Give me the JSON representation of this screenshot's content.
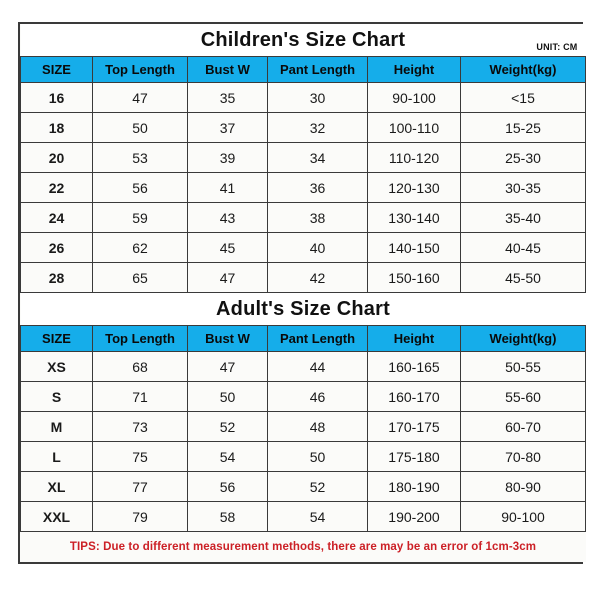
{
  "colors": {
    "header_cyan": "#15adea",
    "border_gray": "#3a3a3a",
    "cell_bg": "#fbfbf9",
    "tips_red": "#cc2026",
    "text_black": "#111111",
    "page_bg": "#ffffff"
  },
  "children_chart": {
    "title": "Children's Size Chart",
    "unit": "UNIT: CM",
    "columns": [
      "SIZE",
      "Top Length",
      "Bust W",
      "Pant Length",
      "Height",
      "Weight(kg)"
    ],
    "rows": [
      [
        "16",
        "47",
        "35",
        "30",
        "90-100",
        "<15"
      ],
      [
        "18",
        "50",
        "37",
        "32",
        "100-110",
        "15-25"
      ],
      [
        "20",
        "53",
        "39",
        "34",
        "110-120",
        "25-30"
      ],
      [
        "22",
        "56",
        "41",
        "36",
        "120-130",
        "30-35"
      ],
      [
        "24",
        "59",
        "43",
        "38",
        "130-140",
        "35-40"
      ],
      [
        "26",
        "62",
        "45",
        "40",
        "140-150",
        "40-45"
      ],
      [
        "28",
        "65",
        "47",
        "42",
        "150-160",
        "45-50"
      ]
    ]
  },
  "adult_chart": {
    "title": "Adult's Size Chart",
    "columns": [
      "SIZE",
      "Top Length",
      "Bust W",
      "Pant Length",
      "Height",
      "Weight(kg)"
    ],
    "rows": [
      [
        "XS",
        "68",
        "47",
        "44",
        "160-165",
        "50-55"
      ],
      [
        "S",
        "71",
        "50",
        "46",
        "160-170",
        "55-60"
      ],
      [
        "M",
        "73",
        "52",
        "48",
        "170-175",
        "60-70"
      ],
      [
        "L",
        "75",
        "54",
        "50",
        "175-180",
        "70-80"
      ],
      [
        "XL",
        "77",
        "56",
        "52",
        "180-190",
        "80-90"
      ],
      [
        "XXL",
        "79",
        "58",
        "54",
        "190-200",
        "90-100"
      ]
    ]
  },
  "footer": {
    "tips": "TIPS: Due to different measurement methods, there are may be an error of 1cm-3cm"
  },
  "chart_data": {
    "type": "table",
    "title": "Children's and Adult's Size Chart",
    "unit": "CM",
    "tables": [
      {
        "name": "Children's Size Chart",
        "columns": [
          "SIZE",
          "Top Length",
          "Bust W",
          "Pant Length",
          "Height",
          "Weight(kg)"
        ],
        "rows": [
          [
            "16",
            "47",
            "35",
            "30",
            "90-100",
            "<15"
          ],
          [
            "18",
            "50",
            "37",
            "32",
            "100-110",
            "15-25"
          ],
          [
            "20",
            "53",
            "39",
            "34",
            "110-120",
            "25-30"
          ],
          [
            "22",
            "56",
            "41",
            "36",
            "120-130",
            "30-35"
          ],
          [
            "24",
            "59",
            "43",
            "38",
            "130-140",
            "35-40"
          ],
          [
            "26",
            "62",
            "45",
            "40",
            "140-150",
            "40-45"
          ],
          [
            "28",
            "65",
            "47",
            "42",
            "150-160",
            "45-50"
          ]
        ]
      },
      {
        "name": "Adult's Size Chart",
        "columns": [
          "SIZE",
          "Top Length",
          "Bust W",
          "Pant Length",
          "Height",
          "Weight(kg)"
        ],
        "rows": [
          [
            "XS",
            "68",
            "47",
            "44",
            "160-165",
            "50-55"
          ],
          [
            "S",
            "71",
            "50",
            "46",
            "160-170",
            "55-60"
          ],
          [
            "M",
            "73",
            "52",
            "48",
            "170-175",
            "60-70"
          ],
          [
            "L",
            "75",
            "54",
            "50",
            "175-180",
            "70-80"
          ],
          [
            "XL",
            "77",
            "56",
            "52",
            "180-190",
            "80-90"
          ],
          [
            "XXL",
            "79",
            "58",
            "54",
            "190-200",
            "90-100"
          ]
        ]
      }
    ],
    "note": "TIPS: Due to different measurement methods, there are may be an error of 1cm-3cm"
  }
}
